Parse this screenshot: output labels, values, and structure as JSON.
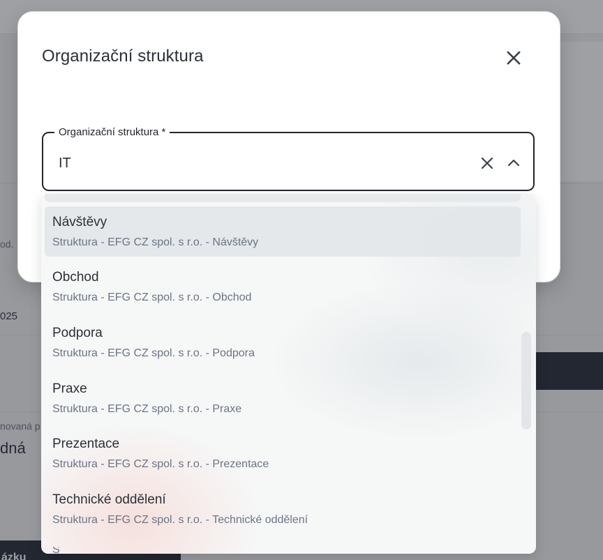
{
  "background": {
    "fragments": {
      "left_text_1": "od.",
      "left_text_2": "025",
      "left_text_3": "novaná p",
      "left_big": "dná",
      "bottom_dark": "ázku"
    }
  },
  "modal": {
    "title": "Organizační struktura",
    "close_icon": "close-icon",
    "field": {
      "label": "Organizační struktura *",
      "value": "IT",
      "clear_icon": "close-icon",
      "toggle_icon": "chevron-up-icon"
    },
    "options": [
      {
        "title": "Návštěvy",
        "path": "Struktura - EFG CZ spol. s r.o. - Návštěvy",
        "highlighted": true
      },
      {
        "title": "Obchod",
        "path": "Struktura - EFG CZ spol. s r.o. - Obchod",
        "highlighted": false
      },
      {
        "title": "Podpora",
        "path": "Struktura - EFG CZ spol. s r.o. - Podpora",
        "highlighted": false
      },
      {
        "title": "Praxe",
        "path": "Struktura - EFG CZ spol. s r.o. - Praxe",
        "highlighted": false
      },
      {
        "title": "Prezentace",
        "path": "Struktura - EFG CZ spol. s r.o. - Prezentace",
        "highlighted": false
      },
      {
        "title": "Technické oddělení",
        "path": "Struktura - EFG CZ spol. s r.o. - Technické oddělení",
        "highlighted": false
      }
    ],
    "partial_next_option": "Š"
  },
  "colors": {
    "text_primary": "#2b3138",
    "text_secondary": "#6b7585",
    "field_border": "#22262c",
    "highlight": "#e2e5e8",
    "scrim": "rgba(40,44,50,0.45)"
  }
}
